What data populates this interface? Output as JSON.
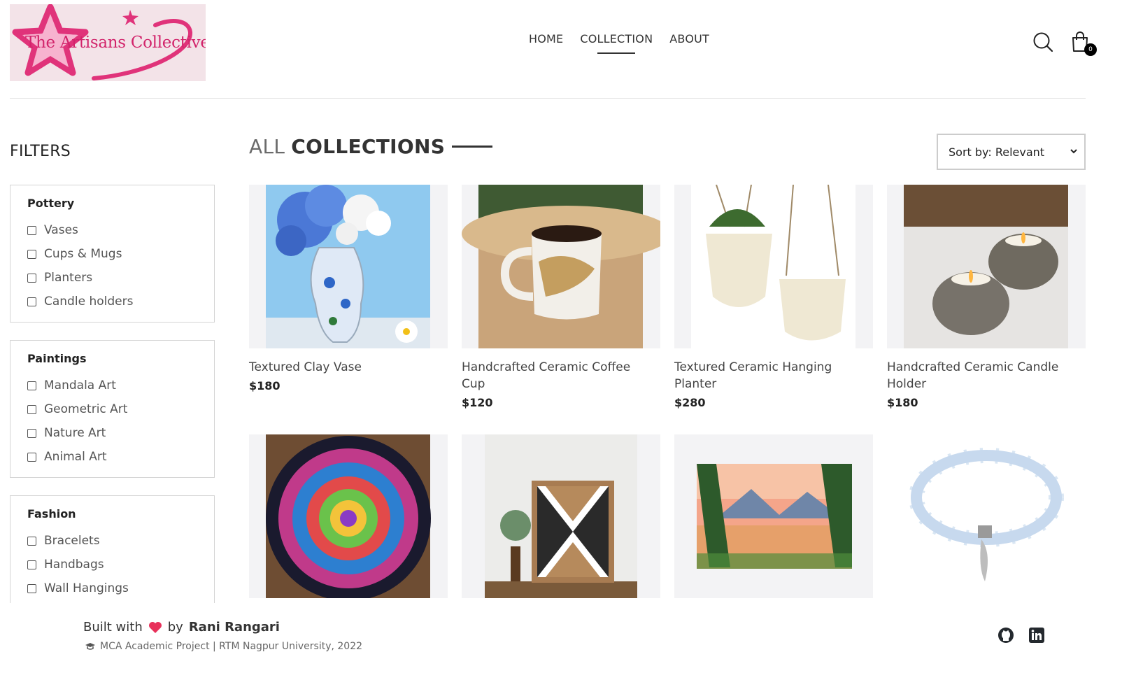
{
  "brand": {
    "logo_text": "The Artisans Collective"
  },
  "nav": {
    "items": [
      {
        "label": "HOME"
      },
      {
        "label": "COLLECTION",
        "active": true
      },
      {
        "label": "ABOUT"
      }
    ]
  },
  "header": {
    "search_icon": "search-icon",
    "cart_icon": "shopping-bag-icon",
    "cart_count": "0"
  },
  "filters": {
    "title": "FILTERS",
    "groups": [
      {
        "name": "Pottery",
        "options": [
          "Vases",
          "Cups & Mugs",
          "Planters",
          "Candle holders"
        ]
      },
      {
        "name": "Paintings",
        "options": [
          "Mandala Art",
          "Geometric Art",
          "Nature Art",
          "Animal Art"
        ]
      },
      {
        "name": "Fashion",
        "options": [
          "Bracelets",
          "Handbags",
          "Wall Hangings"
        ]
      }
    ]
  },
  "collection": {
    "title_light": "ALL",
    "title_bold": "COLLECTIONS",
    "sort_label": "Sort by: Relevant"
  },
  "products": [
    {
      "name": "Textured Clay Vase",
      "price": "$180",
      "image": "blue-flower-vase"
    },
    {
      "name": "Handcrafted Ceramic Coffee Cup",
      "price": "$120",
      "image": "marble-coffee-mug"
    },
    {
      "name": "Textured Ceramic Hanging Planter",
      "price": "$280",
      "image": "hanging-planters"
    },
    {
      "name": "Handcrafted Ceramic Candle Holder",
      "price": "$180",
      "image": "candle-holders"
    },
    {
      "name": "",
      "price": "",
      "image": "dot-mandala"
    },
    {
      "name": "",
      "price": "",
      "image": "geometric-wood-art"
    },
    {
      "name": "",
      "price": "",
      "image": "nature-landscape-painting"
    },
    {
      "name": "",
      "price": "",
      "image": "beaded-bracelet"
    }
  ],
  "footer": {
    "built_with": "Built with",
    "by": "by",
    "author": "Rani Rangari",
    "subline": "MCA Academic Project | RTM Nagpur University, 2022",
    "heart_color": "#e8315b",
    "social_icons": [
      "github-icon",
      "linkedin-icon"
    ]
  },
  "colors": {
    "brand_pink": "#d2246b",
    "logo_bg": "#f3e3e8",
    "card_bg": "#f3f3f5"
  }
}
